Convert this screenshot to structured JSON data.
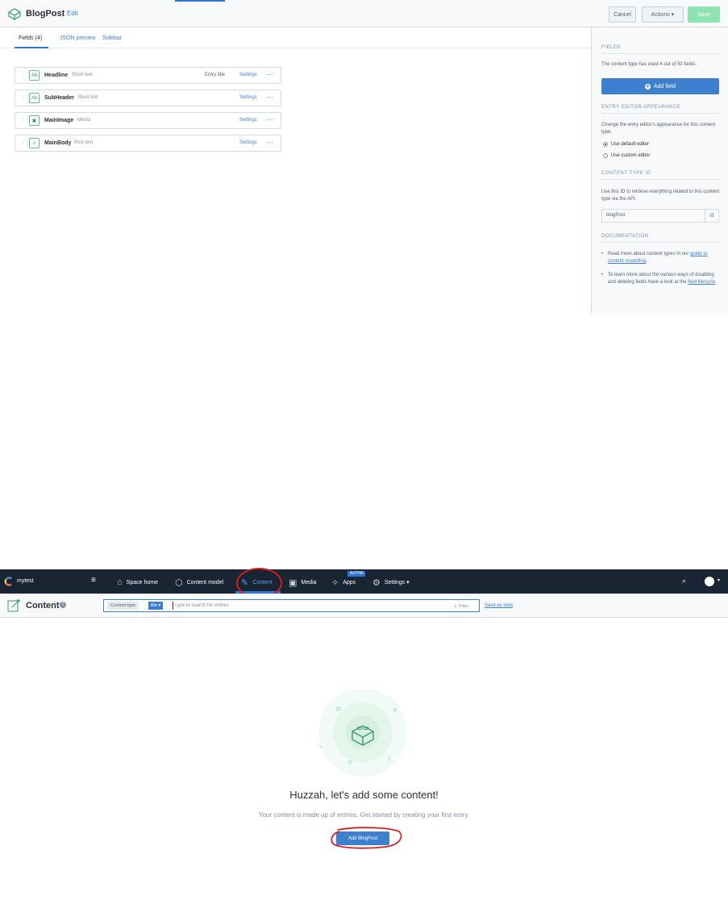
{
  "editor": {
    "title": "BlogPost",
    "edit_link": "Edit",
    "buttons": {
      "cancel": "Cancel",
      "actions": "Actions ▾",
      "save": "Save"
    },
    "tabs": {
      "fields": "Fields (4)",
      "json": "JSON preview",
      "sidebar": "Sidebar"
    },
    "fields": [
      {
        "icon": "Ab",
        "name": "Headline",
        "type": "Short text",
        "entry_title": "Entry title",
        "settings": "Settings",
        "more": "···"
      },
      {
        "icon": "Ab",
        "name": "SubHeader",
        "type": "Short text",
        "entry_title": "",
        "settings": "Settings",
        "more": "···"
      },
      {
        "icon": "▣",
        "name": "MainImage",
        "type": "Media",
        "entry_title": "",
        "settings": "Settings",
        "more": "···"
      },
      {
        "icon": "≡",
        "name": "MainBody",
        "type": "Rich text",
        "entry_title": "",
        "settings": "Settings",
        "more": "···"
      }
    ],
    "sidebar": {
      "fields_heading": "FIELDS",
      "fields_text": "The content type has used 4 out of 50 fields.",
      "add_field": "Add field",
      "appearance_heading": "ENTRY EDITOR APPEARANCE",
      "appearance_text": "Change the entry editor's appearance for this content type.",
      "default_editor": "Use default editor",
      "custom_editor": "Use custom editor",
      "id_heading": "CONTENT TYPE ID",
      "id_text": "Use this ID to retrieve everything related to this content type via the API.",
      "id_value": "blogPost",
      "docs_heading": "DOCUMENTATION",
      "docs_1_pre": "Read more about content types in our ",
      "docs_1_link": "guide to content modelling",
      "docs_1_post": ".",
      "docs_2_pre": "To learn more about the various ways of disabling and deleting fields have a look at the ",
      "docs_2_link": "field lifecycle",
      "docs_2_post": "."
    }
  },
  "content_page": {
    "nav": {
      "space": "mytest",
      "items": [
        "Space home",
        "Content model",
        "Content",
        "Media",
        "Apps",
        "Settings ▾"
      ],
      "alpha_badge": "ALPHA"
    },
    "header": {
      "title": "Content",
      "pill_label": "Content type",
      "pill_value": "Blo ▾",
      "search_placeholder": "Type to search for entries",
      "filter": "Filter",
      "save_view": "Save as view"
    },
    "empty_state": {
      "title": "Huzzah, let's add some content!",
      "subtitle": "Your content is made up of entries. Get started by creating your first entry.",
      "button": "Add BlogPost"
    }
  },
  "colors": {
    "accent": "#3c80cf",
    "nav_bg": "#192532",
    "annotation": "#d41e1e",
    "save_disabled": "#8fe3b0"
  }
}
